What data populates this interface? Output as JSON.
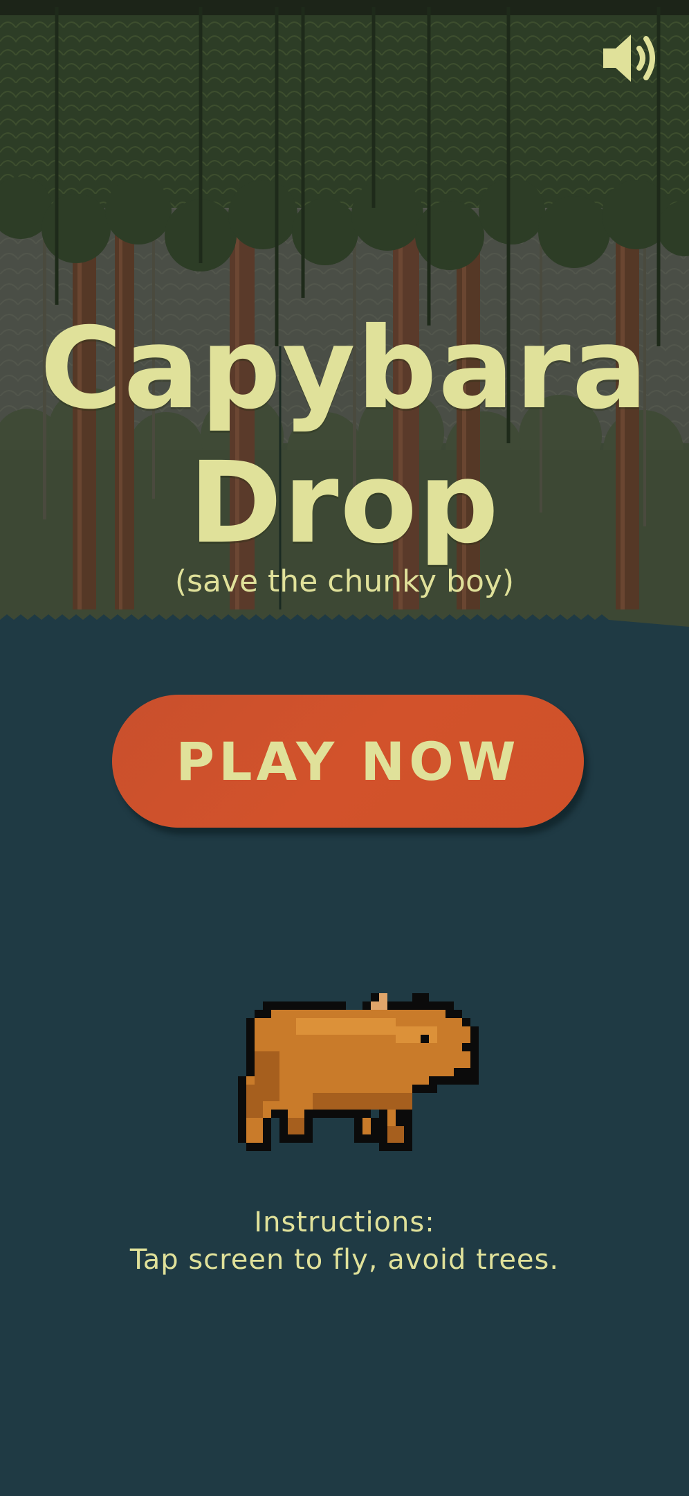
{
  "game": {
    "title_line1": "Capybara",
    "title_line2": "Drop",
    "subtitle": "(save the chunky boy)",
    "play_button_label": "PLAY NOW",
    "instructions_heading": "Instructions:",
    "instructions_text": "Tap screen to fly, avoid trees."
  },
  "icons": {
    "sound": "speaker-volume-icon",
    "character": "capybara-pixel-sprite"
  },
  "colors": {
    "text_cream": "#e0e19a",
    "button_orange": "#cf5129",
    "water_teal": "#1f3a44",
    "canopy_dark": "#2d3d26",
    "trunk_brown": "#5a3a2a"
  }
}
